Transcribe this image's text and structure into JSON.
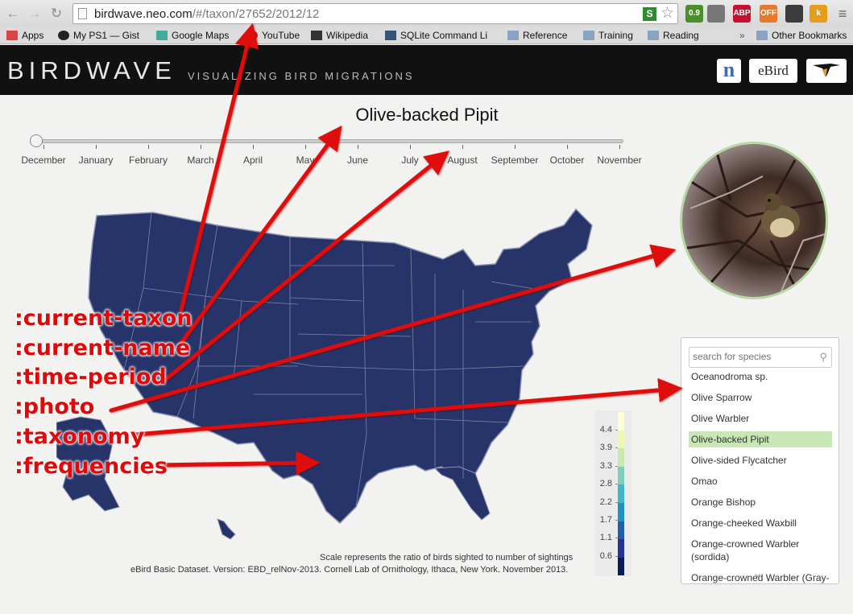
{
  "browser": {
    "url_host": "birdwave.neo.com",
    "url_path": "/#/taxon/27652/2012/12",
    "extensions": [
      {
        "icon": "stats-extension-icon",
        "badge": "0.9",
        "color": "#4a8f2c"
      },
      {
        "icon": "pocket-icon",
        "badge": "",
        "color": "#777777"
      },
      {
        "icon": "adblock-icon",
        "badge": "ABP",
        "color": "#c8102e"
      },
      {
        "icon": "off-extension-icon",
        "badge": "OFF",
        "color": "#e8782a"
      },
      {
        "icon": "hat-extension-icon",
        "badge": "",
        "color": "#3b3b3b"
      },
      {
        "icon": "k-extension-icon",
        "badge": "k",
        "color": "#e69d1a"
      }
    ],
    "bookmarks": [
      {
        "label": "Apps",
        "icon": "apps-grid-icon"
      },
      {
        "label": "My PS1 — Gist",
        "icon": "github-icon"
      },
      {
        "label": "Google Maps",
        "icon": "maps-icon"
      },
      {
        "label": "YouTube",
        "icon": "youtube-icon"
      },
      {
        "label": "Wikipedia",
        "icon": "wikipedia-icon"
      },
      {
        "label": "SQLite Command Li",
        "icon": "sqlite-icon"
      },
      {
        "label": "Reference",
        "icon": "folder-icon"
      },
      {
        "label": "Training",
        "icon": "folder-icon"
      },
      {
        "label": "Reading",
        "icon": "folder-icon"
      },
      {
        "label": "Other Bookmarks",
        "icon": "folder-icon"
      }
    ],
    "overflow": "»"
  },
  "header": {
    "title": "BIRDWAVE",
    "subtitle": "VISUALIZING BIRD MIGRATIONS",
    "logos": {
      "n": "n",
      "ebird": "eBird"
    }
  },
  "species_title": "Olive-backed Pipit",
  "timeline": {
    "months": [
      "December",
      "January",
      "February",
      "March",
      "April",
      "May",
      "June",
      "July",
      "August",
      "September",
      "October",
      "November"
    ],
    "selected_index": 0
  },
  "legend": {
    "labels": [
      "4.4",
      "3.9",
      "3.3",
      "2.8",
      "2.2",
      "1.7",
      "1.1",
      "0.6"
    ],
    "colors": [
      "#ffffd9",
      "#edf8b1",
      "#c7e9b4",
      "#7fcdbb",
      "#41b6c4",
      "#1d91c0",
      "#225ea8",
      "#253494",
      "#081d58"
    ]
  },
  "notes": {
    "scale": "Scale represents the ratio of birds sighted to number of sightings",
    "dataset": "eBird Basic Dataset. Version: EBD_relNov-2013. Cornell Lab of Ornithology, Ithaca, New York. November 2013."
  },
  "map": {
    "fill": "#27346a",
    "border": "#8d93b0"
  },
  "search": {
    "placeholder": "search for species"
  },
  "species_list": [
    {
      "name": "Oceanodroma sp.",
      "selected": false
    },
    {
      "name": "Olive Sparrow",
      "selected": false
    },
    {
      "name": "Olive Warbler",
      "selected": false
    },
    {
      "name": "Olive-backed Pipit",
      "selected": true
    },
    {
      "name": "Olive-sided Flycatcher",
      "selected": false
    },
    {
      "name": "Omao",
      "selected": false
    },
    {
      "name": "Orange Bishop",
      "selected": false
    },
    {
      "name": "Orange-cheeked Waxbill",
      "selected": false
    },
    {
      "name": "Orange-crowned Warbler (sordida)",
      "selected": false
    },
    {
      "name": "Orange-crowned Warbler (Gray-headed)",
      "selected": false
    }
  ],
  "annotations": {
    "color": "#e00808",
    "labels": [
      ":current-taxon",
      ":current-name",
      ":time-period",
      ":photo",
      ":taxonomy",
      ":frequencies"
    ]
  }
}
